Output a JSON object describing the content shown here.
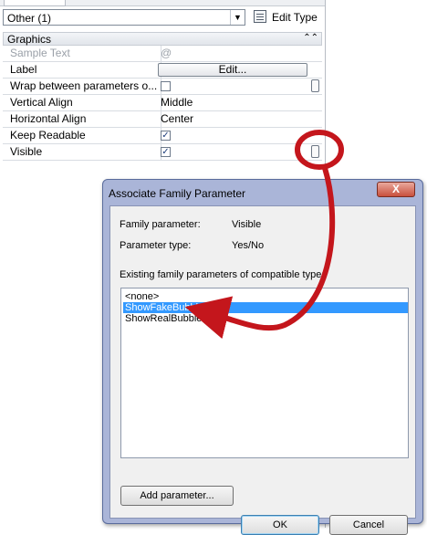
{
  "properties": {
    "type_selector": {
      "value": "Other (1)"
    },
    "edit_type_label": "Edit Type",
    "group": {
      "title": "Graphics",
      "collapse_glyph": "⌃⌃"
    },
    "rows": [
      {
        "name": "Sample Text",
        "value": "@",
        "disabled": true,
        "kind": "text"
      },
      {
        "name": "Label",
        "value": "Edit...",
        "kind": "button"
      },
      {
        "name": "Wrap between parameters o...",
        "checked": false,
        "kind": "check",
        "link": true
      },
      {
        "name": "Vertical Align",
        "value": "Middle",
        "kind": "text"
      },
      {
        "name": "Horizontal Align",
        "value": "Center",
        "kind": "text"
      },
      {
        "name": "Keep Readable",
        "checked": true,
        "kind": "check"
      },
      {
        "name": "Visible",
        "checked": true,
        "kind": "check",
        "link": true
      }
    ]
  },
  "dialog": {
    "title": "Associate Family Parameter",
    "close_glyph": "X",
    "family_parameter_label": "Family parameter:",
    "family_parameter_value": "Visible",
    "parameter_type_label": "Parameter type:",
    "parameter_type_value": "Yes/No",
    "existing_label": "Existing family parameters of compatible type:",
    "list_items": [
      "<none>",
      "ShowFakeBubble",
      "ShowRealBubble"
    ],
    "selected_index": 1,
    "add_parameter_label": "Add parameter...",
    "ok_label": "OK",
    "cancel_label": "Cancel"
  },
  "annotation": {
    "color": "#c4161c"
  },
  "colors": {
    "selection": "#3399ff",
    "dialog_frame": "#aab5d8"
  }
}
